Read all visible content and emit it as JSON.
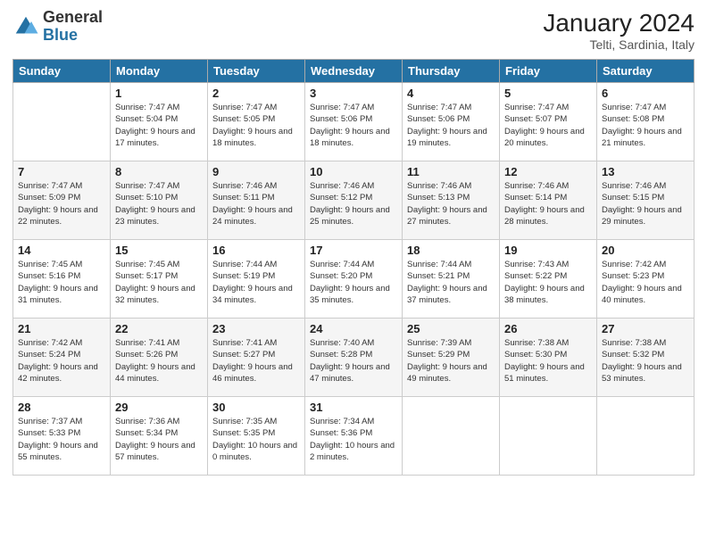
{
  "logo": {
    "text_general": "General",
    "text_blue": "Blue"
  },
  "header": {
    "title": "January 2024",
    "subtitle": "Telti, Sardinia, Italy"
  },
  "weekdays": [
    "Sunday",
    "Monday",
    "Tuesday",
    "Wednesday",
    "Thursday",
    "Friday",
    "Saturday"
  ],
  "weeks": [
    [
      {
        "day": "",
        "sunrise": "",
        "sunset": "",
        "daylight": ""
      },
      {
        "day": "1",
        "sunrise": "Sunrise: 7:47 AM",
        "sunset": "Sunset: 5:04 PM",
        "daylight": "Daylight: 9 hours and 17 minutes."
      },
      {
        "day": "2",
        "sunrise": "Sunrise: 7:47 AM",
        "sunset": "Sunset: 5:05 PM",
        "daylight": "Daylight: 9 hours and 18 minutes."
      },
      {
        "day": "3",
        "sunrise": "Sunrise: 7:47 AM",
        "sunset": "Sunset: 5:06 PM",
        "daylight": "Daylight: 9 hours and 18 minutes."
      },
      {
        "day": "4",
        "sunrise": "Sunrise: 7:47 AM",
        "sunset": "Sunset: 5:06 PM",
        "daylight": "Daylight: 9 hours and 19 minutes."
      },
      {
        "day": "5",
        "sunrise": "Sunrise: 7:47 AM",
        "sunset": "Sunset: 5:07 PM",
        "daylight": "Daylight: 9 hours and 20 minutes."
      },
      {
        "day": "6",
        "sunrise": "Sunrise: 7:47 AM",
        "sunset": "Sunset: 5:08 PM",
        "daylight": "Daylight: 9 hours and 21 minutes."
      }
    ],
    [
      {
        "day": "7",
        "sunrise": "Sunrise: 7:47 AM",
        "sunset": "Sunset: 5:09 PM",
        "daylight": "Daylight: 9 hours and 22 minutes."
      },
      {
        "day": "8",
        "sunrise": "Sunrise: 7:47 AM",
        "sunset": "Sunset: 5:10 PM",
        "daylight": "Daylight: 9 hours and 23 minutes."
      },
      {
        "day": "9",
        "sunrise": "Sunrise: 7:46 AM",
        "sunset": "Sunset: 5:11 PM",
        "daylight": "Daylight: 9 hours and 24 minutes."
      },
      {
        "day": "10",
        "sunrise": "Sunrise: 7:46 AM",
        "sunset": "Sunset: 5:12 PM",
        "daylight": "Daylight: 9 hours and 25 minutes."
      },
      {
        "day": "11",
        "sunrise": "Sunrise: 7:46 AM",
        "sunset": "Sunset: 5:13 PM",
        "daylight": "Daylight: 9 hours and 27 minutes."
      },
      {
        "day": "12",
        "sunrise": "Sunrise: 7:46 AM",
        "sunset": "Sunset: 5:14 PM",
        "daylight": "Daylight: 9 hours and 28 minutes."
      },
      {
        "day": "13",
        "sunrise": "Sunrise: 7:46 AM",
        "sunset": "Sunset: 5:15 PM",
        "daylight": "Daylight: 9 hours and 29 minutes."
      }
    ],
    [
      {
        "day": "14",
        "sunrise": "Sunrise: 7:45 AM",
        "sunset": "Sunset: 5:16 PM",
        "daylight": "Daylight: 9 hours and 31 minutes."
      },
      {
        "day": "15",
        "sunrise": "Sunrise: 7:45 AM",
        "sunset": "Sunset: 5:17 PM",
        "daylight": "Daylight: 9 hours and 32 minutes."
      },
      {
        "day": "16",
        "sunrise": "Sunrise: 7:44 AM",
        "sunset": "Sunset: 5:19 PM",
        "daylight": "Daylight: 9 hours and 34 minutes."
      },
      {
        "day": "17",
        "sunrise": "Sunrise: 7:44 AM",
        "sunset": "Sunset: 5:20 PM",
        "daylight": "Daylight: 9 hours and 35 minutes."
      },
      {
        "day": "18",
        "sunrise": "Sunrise: 7:44 AM",
        "sunset": "Sunset: 5:21 PM",
        "daylight": "Daylight: 9 hours and 37 minutes."
      },
      {
        "day": "19",
        "sunrise": "Sunrise: 7:43 AM",
        "sunset": "Sunset: 5:22 PM",
        "daylight": "Daylight: 9 hours and 38 minutes."
      },
      {
        "day": "20",
        "sunrise": "Sunrise: 7:42 AM",
        "sunset": "Sunset: 5:23 PM",
        "daylight": "Daylight: 9 hours and 40 minutes."
      }
    ],
    [
      {
        "day": "21",
        "sunrise": "Sunrise: 7:42 AM",
        "sunset": "Sunset: 5:24 PM",
        "daylight": "Daylight: 9 hours and 42 minutes."
      },
      {
        "day": "22",
        "sunrise": "Sunrise: 7:41 AM",
        "sunset": "Sunset: 5:26 PM",
        "daylight": "Daylight: 9 hours and 44 minutes."
      },
      {
        "day": "23",
        "sunrise": "Sunrise: 7:41 AM",
        "sunset": "Sunset: 5:27 PM",
        "daylight": "Daylight: 9 hours and 46 minutes."
      },
      {
        "day": "24",
        "sunrise": "Sunrise: 7:40 AM",
        "sunset": "Sunset: 5:28 PM",
        "daylight": "Daylight: 9 hours and 47 minutes."
      },
      {
        "day": "25",
        "sunrise": "Sunrise: 7:39 AM",
        "sunset": "Sunset: 5:29 PM",
        "daylight": "Daylight: 9 hours and 49 minutes."
      },
      {
        "day": "26",
        "sunrise": "Sunrise: 7:38 AM",
        "sunset": "Sunset: 5:30 PM",
        "daylight": "Daylight: 9 hours and 51 minutes."
      },
      {
        "day": "27",
        "sunrise": "Sunrise: 7:38 AM",
        "sunset": "Sunset: 5:32 PM",
        "daylight": "Daylight: 9 hours and 53 minutes."
      }
    ],
    [
      {
        "day": "28",
        "sunrise": "Sunrise: 7:37 AM",
        "sunset": "Sunset: 5:33 PM",
        "daylight": "Daylight: 9 hours and 55 minutes."
      },
      {
        "day": "29",
        "sunrise": "Sunrise: 7:36 AM",
        "sunset": "Sunset: 5:34 PM",
        "daylight": "Daylight: 9 hours and 57 minutes."
      },
      {
        "day": "30",
        "sunrise": "Sunrise: 7:35 AM",
        "sunset": "Sunset: 5:35 PM",
        "daylight": "Daylight: 10 hours and 0 minutes."
      },
      {
        "day": "31",
        "sunrise": "Sunrise: 7:34 AM",
        "sunset": "Sunset: 5:36 PM",
        "daylight": "Daylight: 10 hours and 2 minutes."
      },
      {
        "day": "",
        "sunrise": "",
        "sunset": "",
        "daylight": ""
      },
      {
        "day": "",
        "sunrise": "",
        "sunset": "",
        "daylight": ""
      },
      {
        "day": "",
        "sunrise": "",
        "sunset": "",
        "daylight": ""
      }
    ]
  ]
}
